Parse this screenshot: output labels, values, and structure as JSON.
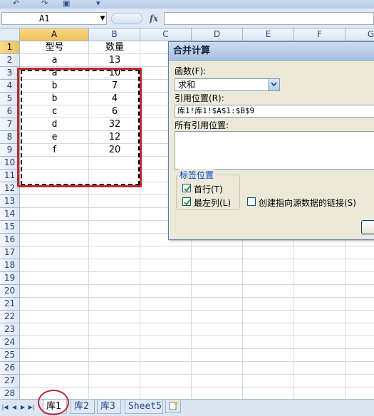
{
  "formula_bar": {
    "name_box": "A1",
    "fx_label": "fx",
    "formula": ""
  },
  "columns": [
    "A",
    "B",
    "C",
    "D",
    "E",
    "F",
    "G"
  ],
  "rows": [
    "1",
    "2",
    "3",
    "4",
    "5",
    "6",
    "7",
    "8",
    "9",
    "10",
    "11",
    "12",
    "13",
    "14",
    "15",
    "16",
    "17",
    "18",
    "19",
    "20",
    "21",
    "22",
    "23",
    "24",
    "25",
    "26",
    "27",
    "28"
  ],
  "table": {
    "headers": [
      "型号",
      "数量"
    ],
    "rows": [
      [
        "a",
        "13"
      ],
      [
        "a",
        "10"
      ],
      [
        "b",
        "7"
      ],
      [
        "b",
        "4"
      ],
      [
        "c",
        "6"
      ],
      [
        "d",
        "32"
      ],
      [
        "e",
        "12"
      ],
      [
        "f",
        "20"
      ]
    ]
  },
  "dialog": {
    "title": "合并计算",
    "function_label": "函数(F):",
    "function_value": "求和",
    "reference_label": "引用位置(R):",
    "reference_value": "库1!库1!$A$1:$B$9",
    "all_references_label": "所有引用位置:",
    "label_group_title": "标签位置",
    "top_row_label": "首行(T)",
    "top_row_checked": true,
    "left_column_label": "最左列(L)",
    "left_column_checked": true,
    "link_label": "创建指向源数据的链接(S)",
    "link_checked": false
  },
  "sheets": [
    {
      "name": "库1",
      "active": true
    },
    {
      "name": "库2",
      "active": false
    },
    {
      "name": "库3",
      "active": false
    },
    {
      "name": "Sheet5",
      "active": false
    }
  ],
  "colors": {
    "accent_red": "#c1272d",
    "header_blue": "#25407a",
    "selected_header": "#f1c05a"
  }
}
